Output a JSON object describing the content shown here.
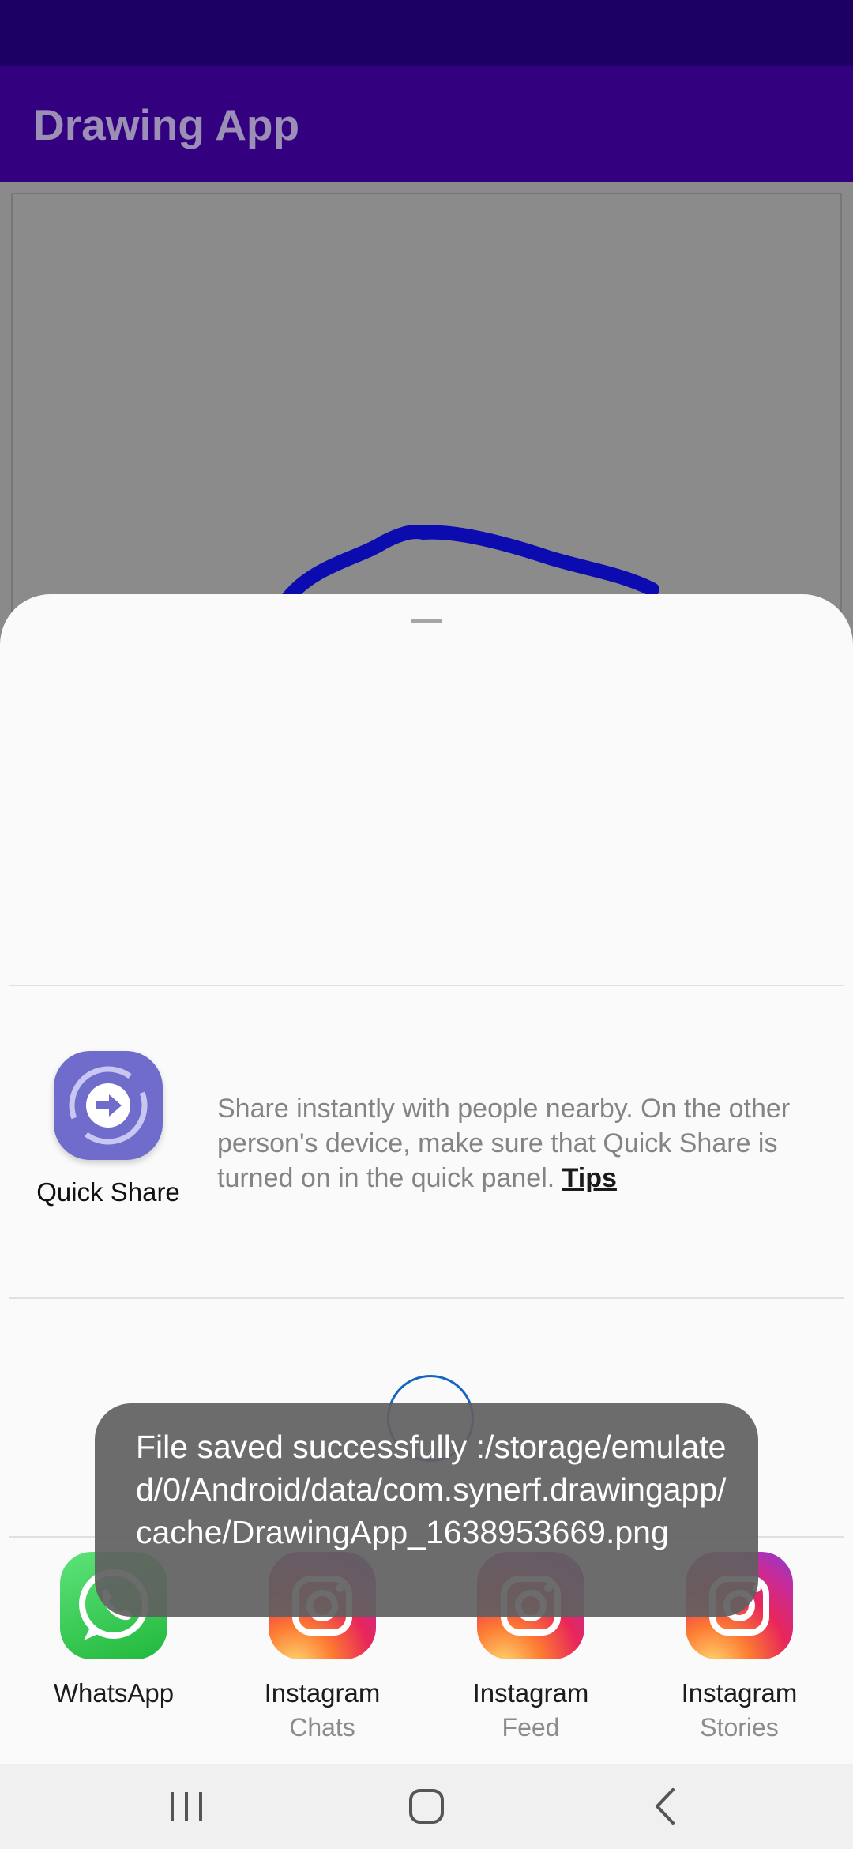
{
  "app": {
    "title": "Drawing App"
  },
  "colors": {
    "status_bar": "#1d0063",
    "app_bar": "#330080",
    "stroke": "#0b0bb0",
    "quick_share": "#6f6ccc"
  },
  "share_sheet": {
    "quick_share": {
      "label": "Quick Share",
      "description": "Share instantly with people nearby. On the other person's device, make sure that Quick Share is turned on in the quick panel.",
      "tips_label": "Tips"
    },
    "apps": [
      {
        "name": "WhatsApp",
        "sub": "",
        "icon": "whatsapp-icon"
      },
      {
        "name": "Instagram",
        "sub": "Chats",
        "icon": "instagram-icon"
      },
      {
        "name": "Instagram",
        "sub": "Feed",
        "icon": "instagram-icon"
      },
      {
        "name": "Instagram",
        "sub": "Stories",
        "icon": "instagram-icon"
      }
    ]
  },
  "toast": {
    "message": "File saved successfully :/storage/emulated/0/Android/data/com.synerf.drawingapp/cache/DrawingApp_1638953669.png"
  },
  "nav": {
    "recents": "recents-icon",
    "home": "home-icon",
    "back": "back-icon"
  }
}
